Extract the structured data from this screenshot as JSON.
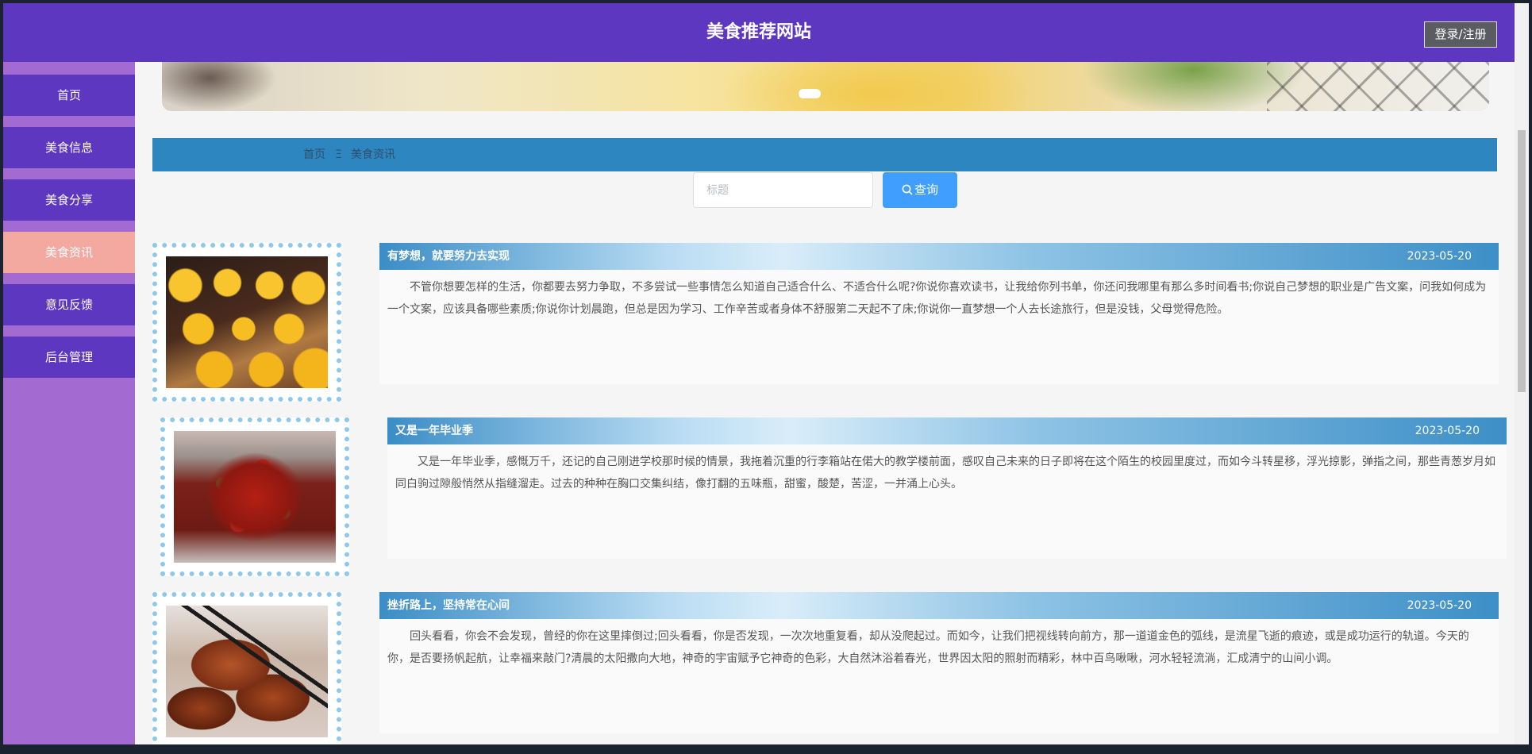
{
  "header": {
    "title": "美食推荐网站",
    "login_label": "登录/注册"
  },
  "sidebar": {
    "items": [
      {
        "label": "首页",
        "active": false
      },
      {
        "label": "美食信息",
        "active": false
      },
      {
        "label": "美食分享",
        "active": false
      },
      {
        "label": "美食资讯",
        "active": true
      },
      {
        "label": "意见反馈",
        "active": false
      },
      {
        "label": "后台管理",
        "active": false
      }
    ]
  },
  "breadcrumb": {
    "home": "首页",
    "separator": "Ξ",
    "current": "美食资讯"
  },
  "search": {
    "placeholder": "标题",
    "value": "",
    "button_label": "查询"
  },
  "news": [
    {
      "title": "有梦想，就要努力去实现",
      "date": "2023-05-20",
      "image": "egg-yolk-pastries",
      "summary": "不管你想要怎样的生活，你都要去努力争取，不多尝试一些事情怎么知道自己适合什么、不适合什么呢?你说你喜欢读书，让我给你列书单，你还问我哪里有那么多时间看书;你说自己梦想的职业是广告文案，问我如何成为一个文案，应该具备哪些素质;你说你计划晨跑，但总是因为学习、工作辛苦或者身体不舒服第二天起不了床;你说你一直梦想一个人去长途旅行，但是没钱，父母觉得危险。"
    },
    {
      "title": "又是一年毕业季",
      "date": "2023-05-20",
      "image": "spicy-crayfish",
      "summary": "又是一年毕业季，感慨万千，还记的自己刚进学校那时候的情景，我拖着沉重的行李箱站在偌大的教学楼前面，感叹自己未来的日子即将在这个陌生的校园里度过，而如今斗转星移，浮光掠影，弹指之间，那些青葱岁月如同白驹过隙般悄然从指缝溜走。过去的种种在胸口交集纠结，像打翻的五味瓶，甜蜜，酸楚，苦涩，一并涌上心头。"
    },
    {
      "title": "挫折路上，坚持常在心间",
      "date": "2023-05-20",
      "image": "braised-pork",
      "summary": "回头看看，你会不会发现，曾经的你在这里摔倒过;回头看看，你是否发现，一次次地重复看，却从没爬起过。而如今，让我们把视线转向前方，那一道道金色的弧线，是流星飞逝的痕迹，或是成功运行的轨道。今天的你，是否要扬帆起航，让幸福来敲门?清晨的太阳撒向大地，神奇的宇宙赋予它神奇的色彩，大自然沐浴着春光，世界因太阳的照射而精彩，林中百鸟啾啾，河水轻轻流淌，汇成清宁的山间小调。"
    }
  ],
  "colors": {
    "header": "#5e37c0",
    "sidebar": "#a36bd1",
    "nav_active": "#f4a9a0",
    "breadcrumb": "#2e86c1",
    "search_button": "#409eff",
    "thumb_border": "#8ec9ec"
  },
  "icons": {
    "search": "search-icon"
  }
}
